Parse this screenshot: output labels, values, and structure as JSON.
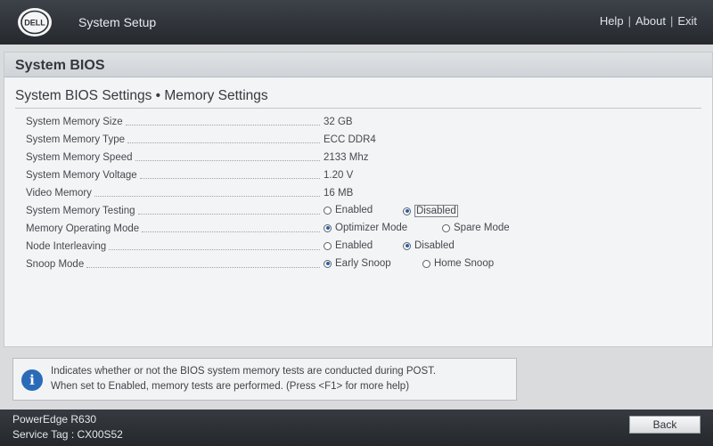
{
  "header": {
    "brand": "DELL",
    "title": "System Setup",
    "links": [
      "Help",
      "About",
      "Exit"
    ]
  },
  "panel": {
    "title": "System BIOS",
    "section_title": "System BIOS Settings • Memory Settings"
  },
  "rows": [
    {
      "label": "System Memory Size",
      "value": "32 GB"
    },
    {
      "label": "System Memory Type",
      "value": "ECC DDR4"
    },
    {
      "label": "System Memory Speed",
      "value": "2133 Mhz"
    },
    {
      "label": "System Memory Voltage",
      "value": "1.20 V"
    },
    {
      "label": "Video Memory",
      "value": "16 MB"
    },
    {
      "label": "System Memory Testing",
      "options": [
        "Enabled",
        "Disabled"
      ],
      "selected": "Disabled"
    },
    {
      "label": "Memory Operating Mode",
      "options": [
        "Optimizer Mode",
        "Spare Mode"
      ],
      "selected": "Optimizer Mode"
    },
    {
      "label": "Node Interleaving",
      "options": [
        "Enabled",
        "Disabled"
      ],
      "selected": "Disabled"
    },
    {
      "label": "Snoop Mode",
      "options": [
        "Early Snoop",
        "Home Snoop"
      ],
      "selected": "Early Snoop"
    }
  ],
  "help": {
    "line1": "Indicates whether or not the BIOS system memory tests are conducted during POST.",
    "line2": "When set to Enabled, memory tests are performed. (Press <F1> for more help)"
  },
  "footer": {
    "model": "PowerEdge R630",
    "service_tag": "Service Tag : CX00S52",
    "back_label": "Back"
  },
  "colors": {
    "accent": "#2a6bb8",
    "bar": "#2c3035"
  }
}
